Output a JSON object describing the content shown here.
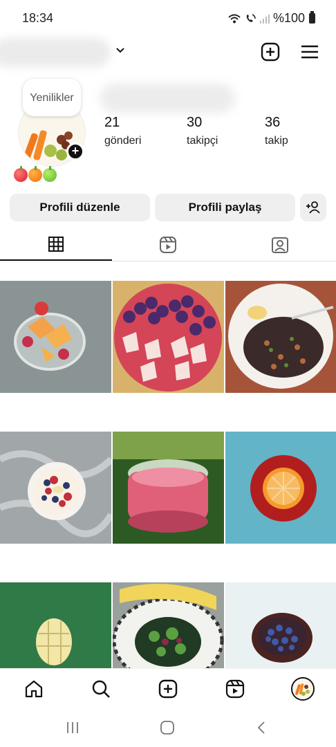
{
  "status_bar": {
    "time": "18:34",
    "battery": "%100",
    "icons": [
      "wifi-icon",
      "volte-icon",
      "signal-icon",
      "battery-icon"
    ]
  },
  "header": {
    "icons": [
      "chevron-down-icon",
      "add-post-icon",
      "menu-icon"
    ]
  },
  "profile": {
    "note": "Yenilikler",
    "stats": [
      {
        "value": "21",
        "label": "gönderi"
      },
      {
        "value": "30",
        "label": "takipçi"
      },
      {
        "value": "36",
        "label": "takip"
      }
    ],
    "bio_emojis": [
      "red-apple",
      "orange",
      "green-apple"
    ]
  },
  "actions": {
    "edit_label": "Profili düzenle",
    "share_label": "Profili paylaş"
  },
  "tabs": [
    "grid-icon",
    "reels-icon",
    "tagged-icon"
  ],
  "posts": [
    "fruit-bowl-melon-strawberry",
    "grapes-strawberries-plate",
    "quinoa-salad-plate",
    "yogurt-berries-bowl",
    "pink-smoothie-jar",
    "orange-slice-plate",
    "mango-on-green",
    "salad-corn-plate",
    "blueberries-bowl"
  ],
  "bottom_nav": [
    "home-icon",
    "search-icon",
    "create-icon",
    "reels-icon",
    "profile-avatar"
  ],
  "colors": {
    "button_bg": "#efefef",
    "text": "#111111",
    "divider": "#e3e3e3"
  }
}
